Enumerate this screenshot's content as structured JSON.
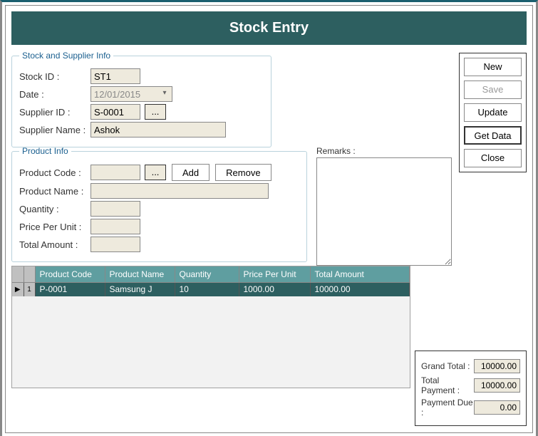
{
  "header": {
    "title": "Stock Entry"
  },
  "actions": {
    "new": "New",
    "save": "Save",
    "update": "Update",
    "get_data": "Get Data",
    "close": "Close"
  },
  "supplier_group": {
    "legend": "Stock and Supplier Info",
    "stock_id_label": "Stock ID :",
    "stock_id_value": "ST1",
    "date_label": "Date :",
    "date_value": "12/01/2015",
    "supplier_id_label": "Supplier ID :",
    "supplier_id_value": "S-0001",
    "browse_label": "...",
    "supplier_name_label": "Supplier Name :",
    "supplier_name_value": "Ashok"
  },
  "product_group": {
    "legend": "Product Info",
    "code_label": "Product Code :",
    "code_value": "",
    "browse_label": "...",
    "add_label": "Add",
    "remove_label": "Remove",
    "name_label": "Product Name :",
    "name_value": "",
    "qty_label": "Quantity :",
    "qty_value": "",
    "unit_label": "Price Per Unit :",
    "unit_value": "",
    "total_label": "Total Amount :",
    "total_value": ""
  },
  "remarks": {
    "label": "Remarks :",
    "value": ""
  },
  "grid": {
    "headers": [
      "Product Code",
      "Product Name",
      "Quantity",
      "Price Per Unit",
      "Total Amount"
    ],
    "row_num": "1",
    "rows": [
      {
        "code": "P-0001",
        "name": "Samsung J",
        "qty": "10",
        "unit": "1000.00",
        "total": "10000.00"
      }
    ]
  },
  "totals": {
    "grand_label": "Grand Total :",
    "grand_value": "10000.00",
    "payment_label": "Total Payment :",
    "payment_value": "10000.00",
    "due_label": "Payment Due :",
    "due_value": "0.00"
  }
}
